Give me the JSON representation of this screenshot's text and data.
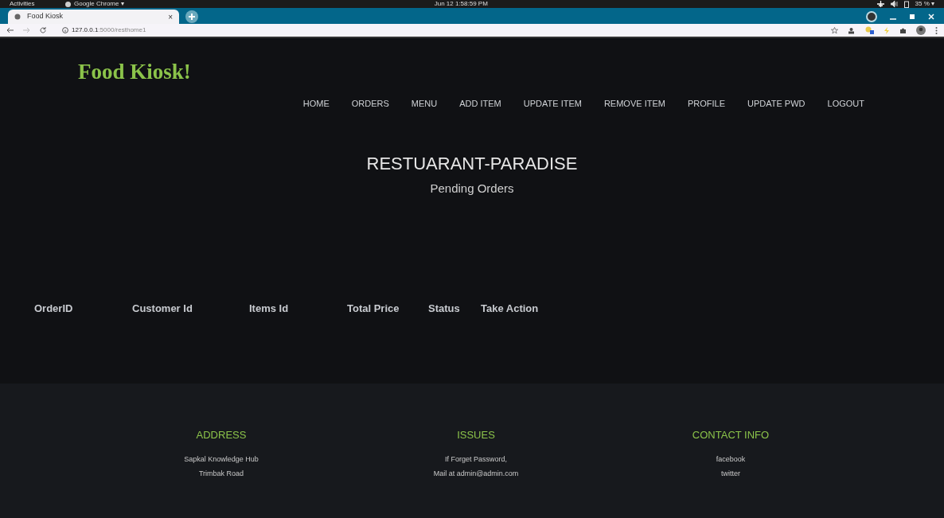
{
  "system_bar": {
    "activities": "Activities",
    "app": "Google Chrome ▾",
    "clock": "Jun 12  1:58:59 PM",
    "battery": "35 % ▾"
  },
  "browser": {
    "tab": {
      "title": "Food Kiosk",
      "close": "×",
      "selected": true
    },
    "url_host": "127.0.0.1",
    "url_path": ":5000/resthome1"
  },
  "site": {
    "logo": "Food Kiosk!",
    "nav": [
      {
        "label": "HOME"
      },
      {
        "label": "ORDERS"
      },
      {
        "label": "MENU"
      },
      {
        "label": "ADD ITEM"
      },
      {
        "label": "UPDATE ITEM"
      },
      {
        "label": "REMOVE ITEM"
      },
      {
        "label": "PROFILE"
      },
      {
        "label": "UPDATE PWD"
      },
      {
        "label": "LOGOUT"
      }
    ]
  },
  "heading": "RESTUARANT-PARADISE",
  "subheading": "Pending Orders",
  "table": {
    "columns": [
      "OrderID",
      "Customer Id",
      "Items Id",
      "Total Price",
      "Status",
      "Take Action"
    ]
  },
  "footer": [
    {
      "title": "ADDRESS",
      "lines": [
        "Sapkal Knowledge Hub",
        "Trimbak Road"
      ]
    },
    {
      "title": "ISSUES",
      "lines": [
        "If Forget Password,",
        "Mail at admin@admin.com"
      ]
    },
    {
      "title": "CONTACT INFO",
      "lines": [
        "facebook",
        "twitter"
      ]
    }
  ]
}
